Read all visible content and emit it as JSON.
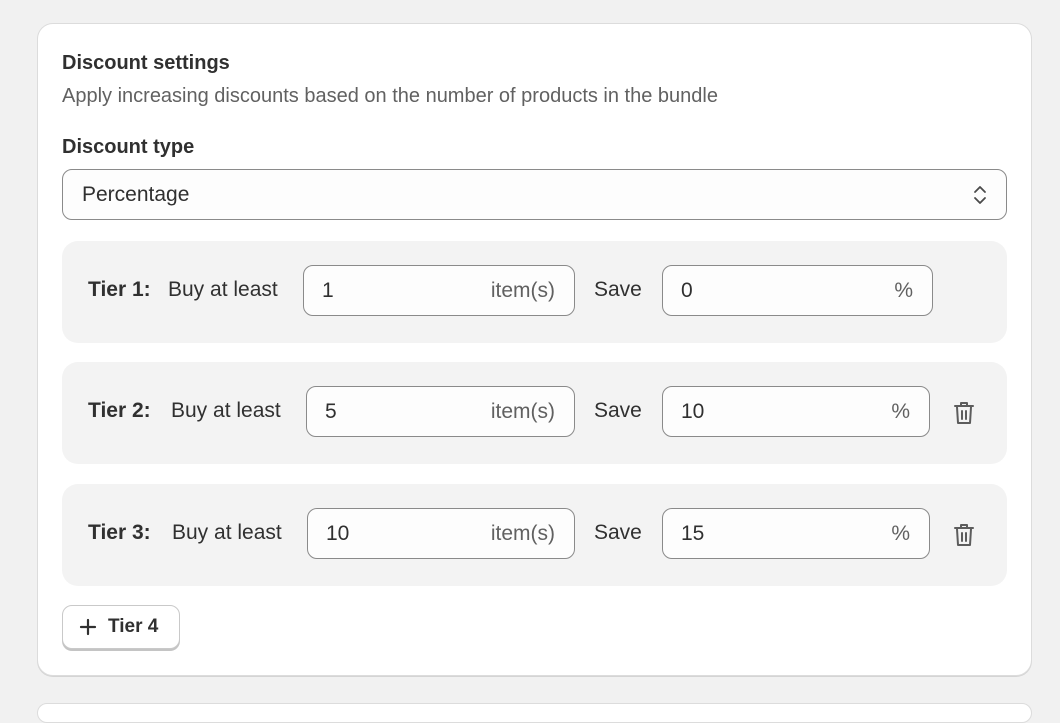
{
  "discount": {
    "title": "Discount settings",
    "subtitle": "Apply increasing discounts based on the number of products in the bundle",
    "type_label": "Discount type",
    "type_value": "Percentage"
  },
  "tiers": [
    {
      "label": "Tier 1:",
      "buy_label": "Buy at least",
      "quantity": "1",
      "quantity_suffix": "item(s)",
      "save_label": "Save",
      "discount": "0",
      "discount_suffix": "%",
      "deletable": false
    },
    {
      "label": "Tier 2:",
      "buy_label": "Buy at least",
      "quantity": "5",
      "quantity_suffix": "item(s)",
      "save_label": "Save",
      "discount": "10",
      "discount_suffix": "%",
      "deletable": true
    },
    {
      "label": "Tier 3:",
      "buy_label": "Buy at least",
      "quantity": "10",
      "quantity_suffix": "item(s)",
      "save_label": "Save",
      "discount": "15",
      "discount_suffix": "%",
      "deletable": true
    }
  ],
  "add_tier_label": "Tier 4",
  "icons": {
    "select": "chevron-up-down-icon",
    "delete": "trash-icon",
    "add": "plus-icon"
  }
}
